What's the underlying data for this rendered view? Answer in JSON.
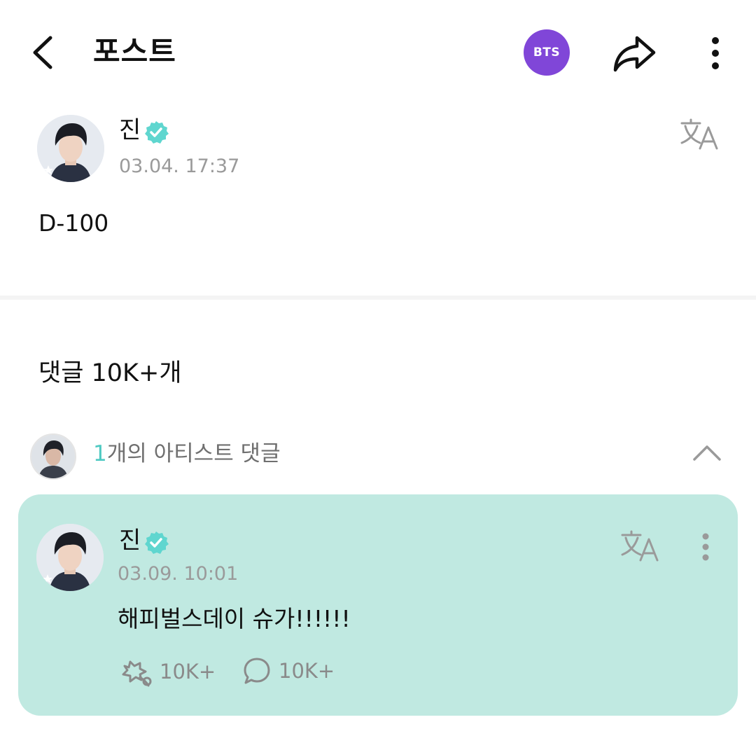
{
  "header": {
    "title": "포스트",
    "community_badge": "BTS",
    "community_color": "#8046d8"
  },
  "post": {
    "author": "진",
    "timestamp": "03.04. 17:37",
    "body": "D-100"
  },
  "comments": {
    "header": "댓글 10K+개",
    "artist_section": {
      "count": "1",
      "label": "개의 아티스트 댓글"
    },
    "artist_comment": {
      "author": "진",
      "timestamp": "03.09. 10:01",
      "body": "해피벌스데이 슈가!!!!!!",
      "likes": "10K+",
      "replies": "10K+",
      "card_color": "#c0e9e1"
    }
  },
  "colors": {
    "verified": "#5fd6cf",
    "accent": "#4ec9c2"
  },
  "icons": [
    "back-arrow-icon",
    "share-icon",
    "more-vertical-icon",
    "verified-badge-icon",
    "translate-icon",
    "chevron-up-icon",
    "like-icon",
    "comment-bubble-icon"
  ]
}
